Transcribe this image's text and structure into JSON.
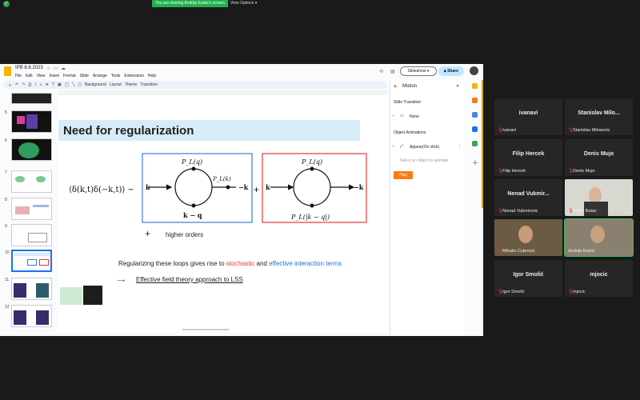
{
  "zoom": {
    "viewing_banner": "You are viewing Andrija Kostic's screen",
    "view_options": "View Options ▾"
  },
  "doc": {
    "title": "IPB 8.6.2023",
    "menu": [
      "File",
      "Edit",
      "View",
      "Insert",
      "Format",
      "Slide",
      "Arrange",
      "Tools",
      "Extensions",
      "Help"
    ],
    "slideshow_label": "Slideshow",
    "share_label": "Share",
    "toolbar": {
      "background": "Background",
      "layout": "Layout",
      "theme": "Theme",
      "transition": "Transition"
    }
  },
  "filmstrip": {
    "numbers": [
      "5",
      "6",
      "7",
      "8",
      "9",
      "10",
      "11",
      "12"
    ]
  },
  "slide": {
    "title": "Need for regularization",
    "lhs": "⟨δ(k,t)δ(−k,t)⟩ ~",
    "left_diagram": {
      "top": "P_L(q)",
      "bottom": "k − q",
      "vertex": "P_L(k)",
      "k_in": "k",
      "k_out": "−k"
    },
    "plus": "+",
    "right_diagram": {
      "top": "P_L(q)",
      "bottom": "P_L(|k − q|)",
      "k_in": "k",
      "k_out": "−k"
    },
    "higher_plus": "+",
    "higher_orders": "higher orders",
    "reg_prefix": "Regularizing these loops gives rise to ",
    "reg_stochastic": "stochastic",
    "reg_and": " and ",
    "reg_effective": "effective interaction terms",
    "eft_arrow": "⟶",
    "eft_text": "Effective field theory approach to LSS",
    "colors": {
      "stochastic": "#e53935",
      "effective": "#1e6fd9",
      "left_box": "#3a7bd5",
      "right_box": "#d93a3a"
    }
  },
  "motion": {
    "title": "Motion",
    "slide_transition": "Slide Transition",
    "none": "None",
    "object_animations": "Object Animations",
    "appear": "Appear",
    "on_click": "(On click)",
    "select_object": "Select an object to animate",
    "play": "Play"
  },
  "participants": [
    {
      "name": "ivanavi",
      "label": "ivanavi",
      "video": false
    },
    {
      "name": "Stanislav Milo...",
      "label": "Stanislav Milosevic",
      "video": false
    },
    {
      "name": "Filip Hercek",
      "label": "Filip Hercek",
      "video": false
    },
    {
      "name": "Denis Mujo",
      "label": "Denis Mujo",
      "video": false
    },
    {
      "name": "Nenad Vukmir...",
      "label": "Nenad Vukmirovic",
      "video": false
    },
    {
      "name": "",
      "label": "Antun Balaz",
      "video": true
    },
    {
      "name": "",
      "label": "Mihailo Cubrovic",
      "video": true
    },
    {
      "name": "",
      "label": "Andrija Kostic",
      "video": true,
      "speaking": true
    },
    {
      "name": "Igor Smolić",
      "label": "Igor Smolić",
      "video": false
    },
    {
      "name": "mjocic",
      "label": "mjocic",
      "video": false
    }
  ]
}
